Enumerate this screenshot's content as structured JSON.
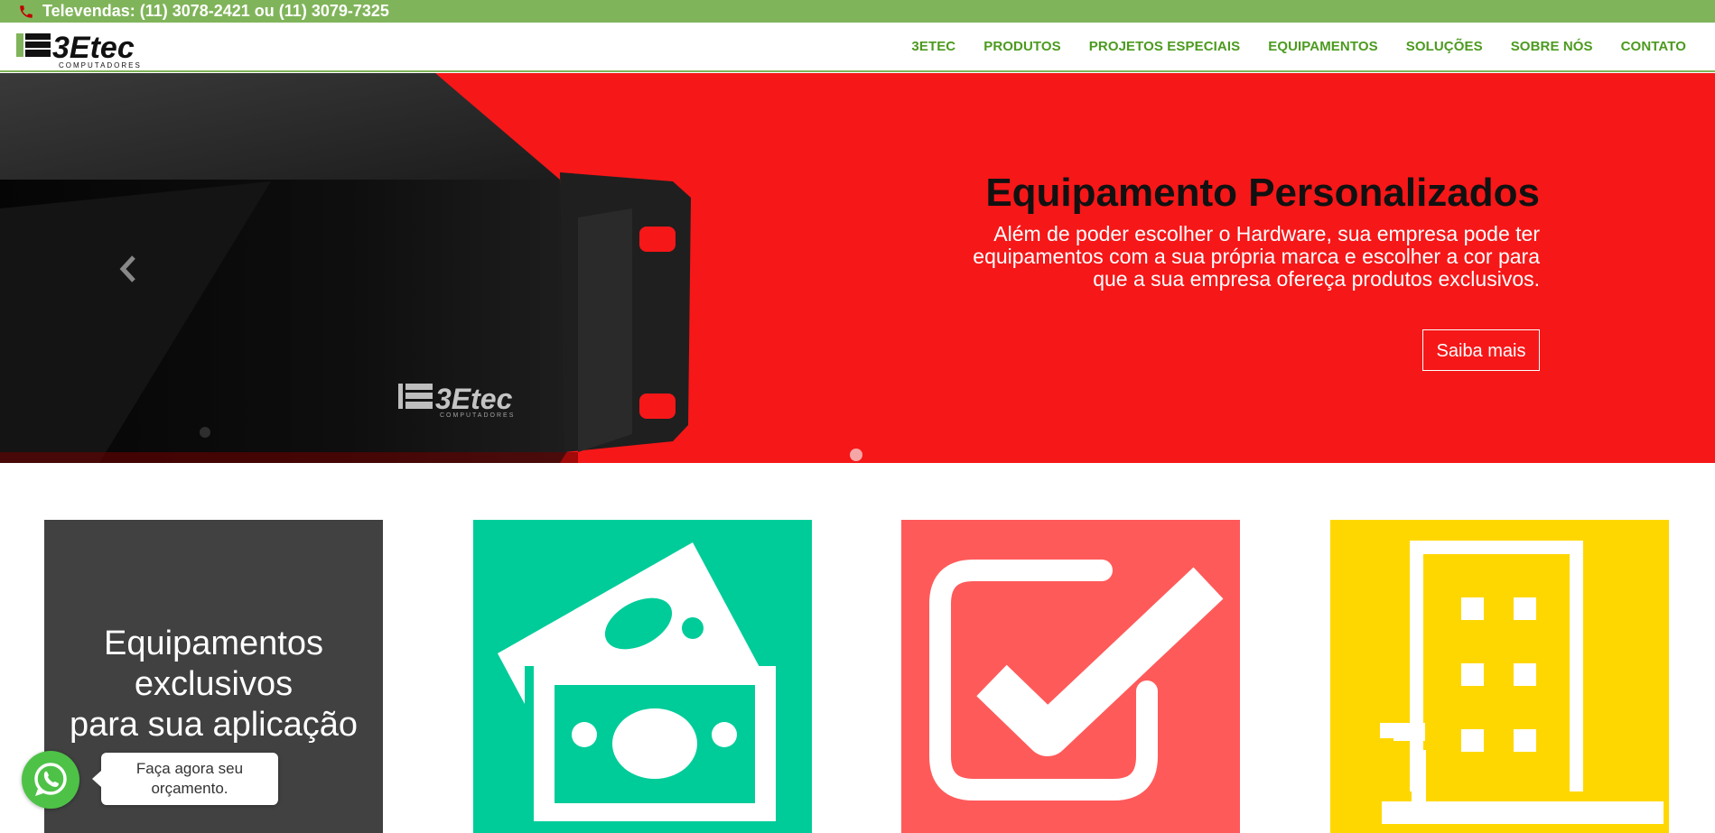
{
  "topbar": {
    "phone_text": "Televendas: (11) 3078-2421 ou (11) 3079-7325",
    "icon": "phone-icon"
  },
  "header": {
    "logo_text": "3Etec",
    "logo_subtext": "COMPUTADORES",
    "nav": [
      {
        "label": "3ETEC"
      },
      {
        "label": "PRODUTOS"
      },
      {
        "label": "PROJETOS ESPECIAIS"
      },
      {
        "label": "EQUIPAMENTOS"
      },
      {
        "label": "SOLUÇÕES"
      },
      {
        "label": "SOBRE NÓS"
      },
      {
        "label": "CONTATO"
      }
    ]
  },
  "hero": {
    "title": "Equipamento Personalizados",
    "text": "Além de poder escolher o Hardware, sua empresa pode ter equipamentos com a sua própria marca e escolher a cor para que a sua empresa ofereça produtos exclusivos.",
    "button_label": "Saiba mais",
    "device_logo_text": "3Etec",
    "device_logo_subtext": "COMPUTADORES",
    "prev_icon": "chevron-left-icon",
    "background_color": "#f61718"
  },
  "tiles": [
    {
      "line1": "Equipamentos",
      "line2": "exclusivos",
      "line3": "para sua aplicação",
      "color": "#414141"
    },
    {
      "icon": "money-icon",
      "color": "#00cc99"
    },
    {
      "icon": "checkbox-check-icon",
      "color": "#ff5a5a"
    },
    {
      "icon": "building-icon",
      "color": "#ffd700"
    }
  ],
  "whatsapp": {
    "icon": "whatsapp-icon",
    "bubble_text": "Faça agora seu orçamento."
  },
  "colors": {
    "accent_green": "#80b45a",
    "nav_green": "#4c9a1f"
  }
}
